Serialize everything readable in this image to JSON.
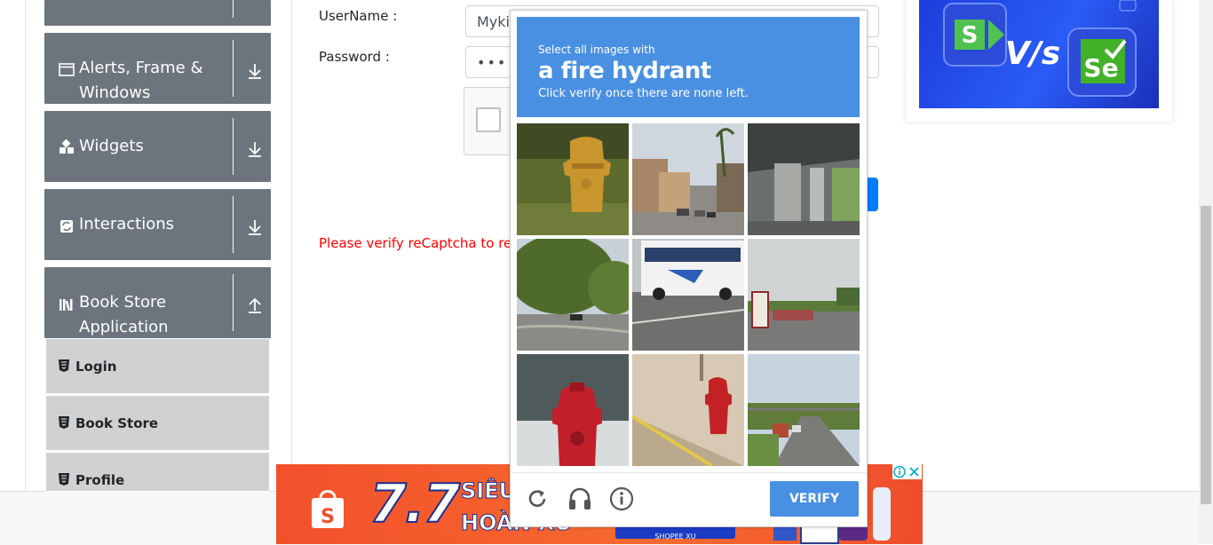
{
  "sidebar": {
    "groups": [
      {
        "label": ""
      },
      {
        "label_line1": "Alerts, Frame &",
        "label_line2": "Windows",
        "icon": "window-icon",
        "arrow": "download-arrow-icon"
      },
      {
        "label": "Widgets",
        "icon": "widgets-icon",
        "arrow": "download-arrow-icon"
      },
      {
        "label": "Interactions",
        "icon": "interactions-icon",
        "arrow": "download-arrow-icon"
      },
      {
        "label_line1": "Book Store",
        "label_line2": "Application",
        "icon": "books-icon",
        "arrow": "upload-arrow-icon"
      }
    ],
    "sub_items": [
      {
        "label": "Login",
        "icon": "html5-icon"
      },
      {
        "label": "Book Store",
        "icon": "html5-icon"
      },
      {
        "label": "Profile",
        "icon": "html5-icon"
      }
    ]
  },
  "form": {
    "username_label": "UserName :",
    "username_value": "Myki",
    "password_label": "Password :",
    "password_value": "•••••",
    "error_message": "Please verify reCaptcha to regi"
  },
  "captcha": {
    "instruction_small": "Select all images with",
    "target": "a fire hydrant",
    "instruction_sub": "Click verify once there are none left.",
    "verify_label": "VERIFY",
    "tiles": [
      {
        "scene": "yellow fire hydrant in grass"
      },
      {
        "scene": "city street with palm trees"
      },
      {
        "scene": "highway underpass"
      },
      {
        "scene": "trees and parking lot"
      },
      {
        "scene": "city bus on road"
      },
      {
        "scene": "road with signs"
      },
      {
        "scene": "red fire hydrant close-up"
      },
      {
        "scene": "red fire hydrant on sidewalk"
      },
      {
        "scene": "highway with truck"
      }
    ],
    "footer_icons": [
      "reload-icon",
      "audio-icon",
      "info-icon"
    ]
  },
  "banner": {
    "big_text": "7.7",
    "line1": "SIÊU",
    "line2": "HOÀN XU",
    "small_text": "SHOPEE XU"
  },
  "colors": {
    "sidebar_group": "#6c757d",
    "sub_item": "#d1d1d1",
    "captcha_blue": "#4a90e2",
    "error_red": "#ff0000",
    "primary_blue": "#007bff",
    "banner_orange": "#f2502b"
  }
}
